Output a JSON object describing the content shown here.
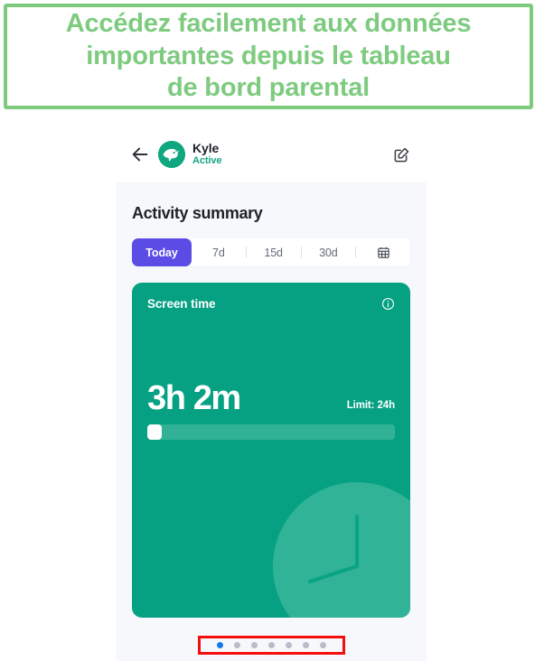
{
  "banner": {
    "text": "Accédez facilement aux données\nimportantes depuis le tableau\nde bord parental",
    "border_color": "#7ecb80",
    "text_color": "#7ecb80"
  },
  "app_header": {
    "back_icon": "back-arrow-icon",
    "avatar_icon": "child-avatar-logo",
    "child_name": "Kyle",
    "child_status": "Active",
    "status_color": "#17a583",
    "edit_icon": "edit-pencil-icon"
  },
  "main": {
    "section_title": "Activity summary",
    "range_selector": {
      "active": "Today",
      "options": [
        "Today",
        "7d",
        "15d",
        "30d"
      ],
      "calendar_icon": "calendar-icon",
      "active_color": "#5b4ce6"
    },
    "screen_time_card": {
      "title": "Screen time",
      "info_icon": "info-circle-icon",
      "value": "3h 2m",
      "limit_label": "Limit: 24h",
      "progress_percent": 6,
      "card_color": "#06a183",
      "decoration_icon": "clock-decoration-icon"
    }
  },
  "pagination": {
    "total_dots": 7,
    "active_index": 0,
    "active_color": "#1479ef",
    "inactive_color": "#b6bcc8",
    "highlight_color": "#f40e0e"
  }
}
